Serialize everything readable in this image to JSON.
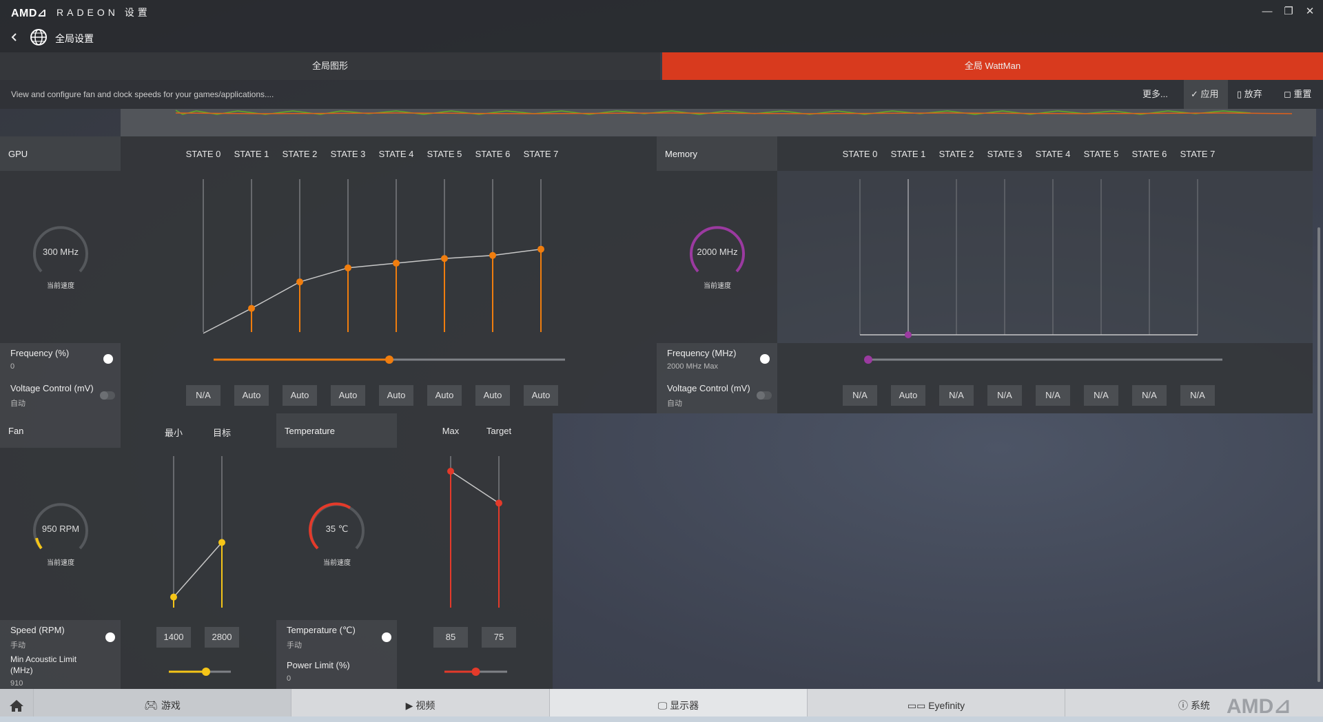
{
  "app": {
    "logo": "AMD⊿",
    "title": "RADEON 设置"
  },
  "window_controls": {
    "minimize": "—",
    "maximize": "❐",
    "close": "✕"
  },
  "nav": {
    "back_icon": "chevron-left-icon",
    "globe_icon": "globe-icon",
    "title": "全局设置"
  },
  "tabs": [
    {
      "label": "全局图形",
      "active": false
    },
    {
      "label": "全局 WattMan",
      "active": true
    }
  ],
  "description": "View and configure fan and clock speeds for your games/applications....",
  "actions": {
    "more": "更多...",
    "apply": "应用",
    "discard": "放弃",
    "reset": "重置"
  },
  "colors": {
    "accent": "#d83a1e",
    "gpu_line": "#f07d0e",
    "mem": "#9b3aa0",
    "fan": "#f5c518",
    "temp": "#e43a2a"
  },
  "gpu": {
    "header": "GPU",
    "states": [
      "STATE 0",
      "STATE 1",
      "STATE 2",
      "STATE 3",
      "STATE 4",
      "STATE 5",
      "STATE 6",
      "STATE 7"
    ],
    "gauge_value": "300 MHz",
    "gauge_label": "当前速度",
    "state_levels": [
      0.01,
      0.17,
      0.34,
      0.43,
      0.46,
      0.49,
      0.51,
      0.55
    ],
    "frequency": {
      "label": "Frequency (%)",
      "value": "0",
      "slider": 0.5
    },
    "voltage": {
      "label": "Voltage Control (mV)",
      "value": "自动",
      "boxes": [
        "N/A",
        "Auto",
        "Auto",
        "Auto",
        "Auto",
        "Auto",
        "Auto",
        "Auto"
      ]
    }
  },
  "memory": {
    "header": "Memory",
    "states": [
      "STATE 0",
      "STATE 1",
      "STATE 2",
      "STATE 3",
      "STATE 4",
      "STATE 5",
      "STATE 6",
      "STATE 7"
    ],
    "gauge_value": "2000 MHz",
    "gauge_label": "当前速度",
    "frequency": {
      "label": "Frequency (MHz)",
      "value": "2000 MHz Max",
      "slider": 0.0
    },
    "voltage": {
      "label": "Voltage Control (mV)",
      "value": "自动",
      "boxes": [
        "N/A",
        "Auto",
        "N/A",
        "N/A",
        "N/A",
        "N/A",
        "N/A",
        "N/A"
      ]
    }
  },
  "fan": {
    "header": "Fan",
    "col_min": "最小",
    "col_target": "目标",
    "gauge_value": "950 RPM",
    "gauge_label": "当前速度",
    "min_level": 0.07,
    "target_level": 0.43,
    "speed": {
      "label": "Speed (RPM)",
      "value": "手动",
      "min": "1400",
      "target": "2800"
    },
    "acoustic": {
      "label_1": "Min Acoustic Limit",
      "label_2": "(MHz)",
      "value": "910",
      "slider": 0.6
    }
  },
  "temperature": {
    "header": "Temperature",
    "col_max": "Max",
    "col_target": "Target",
    "gauge_value": "35 ℃",
    "gauge_label": "当前速度",
    "max_level": 0.9,
    "target_level": 0.69,
    "row": {
      "label": "Temperature (℃)",
      "value": "手动",
      "max": "85",
      "target": "75"
    },
    "power": {
      "label": "Power Limit (%)",
      "value": "0",
      "slider": 0.5
    }
  },
  "taskbar": {
    "home_icon": "home-icon",
    "items": [
      {
        "icon": "gamepad-icon",
        "label": "游戏"
      },
      {
        "icon": "play-icon",
        "label": "视频"
      },
      {
        "icon": "monitor-icon",
        "label": "显示器"
      },
      {
        "icon": "eyefinity-icon",
        "label": "Eyefinity"
      },
      {
        "icon": "info-icon",
        "label": "系统"
      }
    ],
    "watermark": "AMD⊿"
  }
}
